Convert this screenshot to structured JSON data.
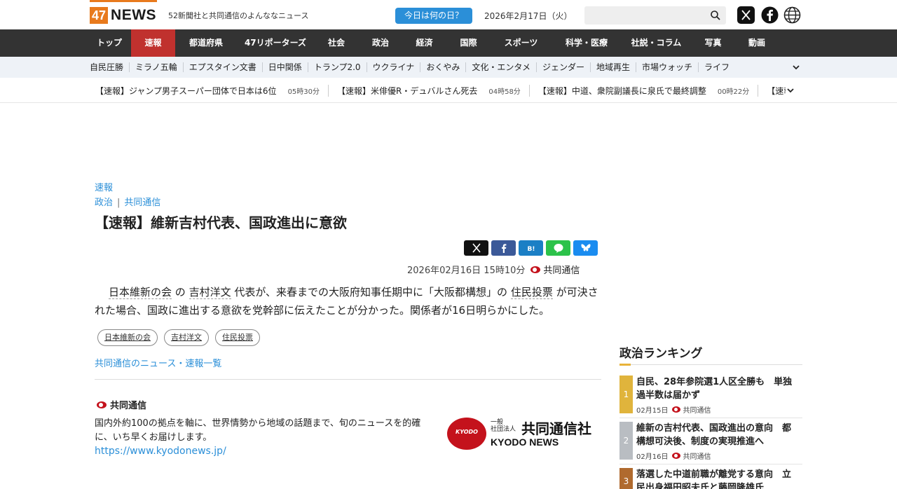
{
  "header": {
    "logo_num": "47",
    "logo_text": "NEWS",
    "tagline": "52新聞社と共同通信のよんななニュース",
    "today_button": "今日は何の日？",
    "date": "2026年2月17日（火）",
    "search_placeholder": ""
  },
  "mainnav": {
    "items": [
      "トップ",
      "速報",
      "都道府県",
      "47リポーターズ",
      "社会",
      "政治",
      "経済",
      "国際",
      "スポーツ",
      "科学・医療",
      "社説・コラム",
      "写真",
      "動画"
    ],
    "active": "速報"
  },
  "subnav": {
    "items": [
      "自民圧勝",
      "ミラノ五輪",
      "エプスタイン文書",
      "日中関係",
      "トランプ2.0",
      "ウクライナ",
      "おくやみ",
      "文化・エンタメ",
      "ジェンダー",
      "地域再生",
      "市場ウォッチ",
      "ライフ"
    ]
  },
  "ticker": {
    "items": [
      {
        "title": "【速報】ジャンプ男子スーパー団体で日本は6位",
        "time": "05時30分"
      },
      {
        "title": "【速報】米俳優R・デュバルさん死去",
        "time": "04時58分"
      },
      {
        "title": "【速報】中道、衆院副議長に泉氏で最終調整",
        "time": "00時22分"
      },
      {
        "title": "【速報】",
        "time": ""
      }
    ]
  },
  "article": {
    "category": "速報",
    "subcat1": "政治",
    "subcat_sep": "|",
    "subcat2": "共同通信",
    "title": "【速報】維新吉村代表、国政進出に意欲",
    "datetime": "2026年02月16日 15時10分",
    "source": "共同通信",
    "body": {
      "kw1": "日本維新の会",
      "t1": " の ",
      "kw2": "吉村洋文",
      "t2": " 代表が、来春までの大阪府知事任期中に「大阪都構想」の ",
      "kw3": "住民投票",
      "t3": " が可決された場合、国政に進出する意欲を党幹部に伝えたことが分かった。関係者が16日明らかにした。"
    },
    "tags": [
      "日本維新の会",
      "吉村洋文",
      "住民投票"
    ],
    "more_link": "共同通信のニュース・速報一覧"
  },
  "source_box": {
    "name": "共同通信",
    "description": "国内外約100の拠点を軸に、世界情勢から地域の話題まで、旬のニュースを的確に、いち早くお届けします。",
    "url": "https://www.kyodonews.jp/",
    "logo_small": "一般\n社団法人",
    "logo_big": "共同通信社",
    "logo_en": "KYODO NEWS",
    "logo_ball": "KYODO"
  },
  "ranking": {
    "title": "政治ランキング",
    "items": [
      {
        "rank": "1",
        "title": "自民、28年参院選1人区全勝も　単独過半数は届かず",
        "date": "02月15日",
        "source": "共同通信",
        "color": "#e0b43c"
      },
      {
        "rank": "2",
        "title": "維新の吉村代表、国政進出の意向　都構想可決後、制度の実現推進へ",
        "date": "02月16日",
        "source": "共同通信",
        "color": "#b9bdc2"
      },
      {
        "rank": "3",
        "title": "落選した中道前職が離党する意向　立民出身福田昭夫氏と藤岡隆雄氏",
        "date": "",
        "source": "",
        "color": "#b06a2e"
      }
    ]
  },
  "colors": {
    "accent": "#e87a1d",
    "nav_bg": "#333333",
    "nav_active": "#c0312e",
    "link": "#2b8fd8",
    "kyodo_red": "#c4121c"
  }
}
